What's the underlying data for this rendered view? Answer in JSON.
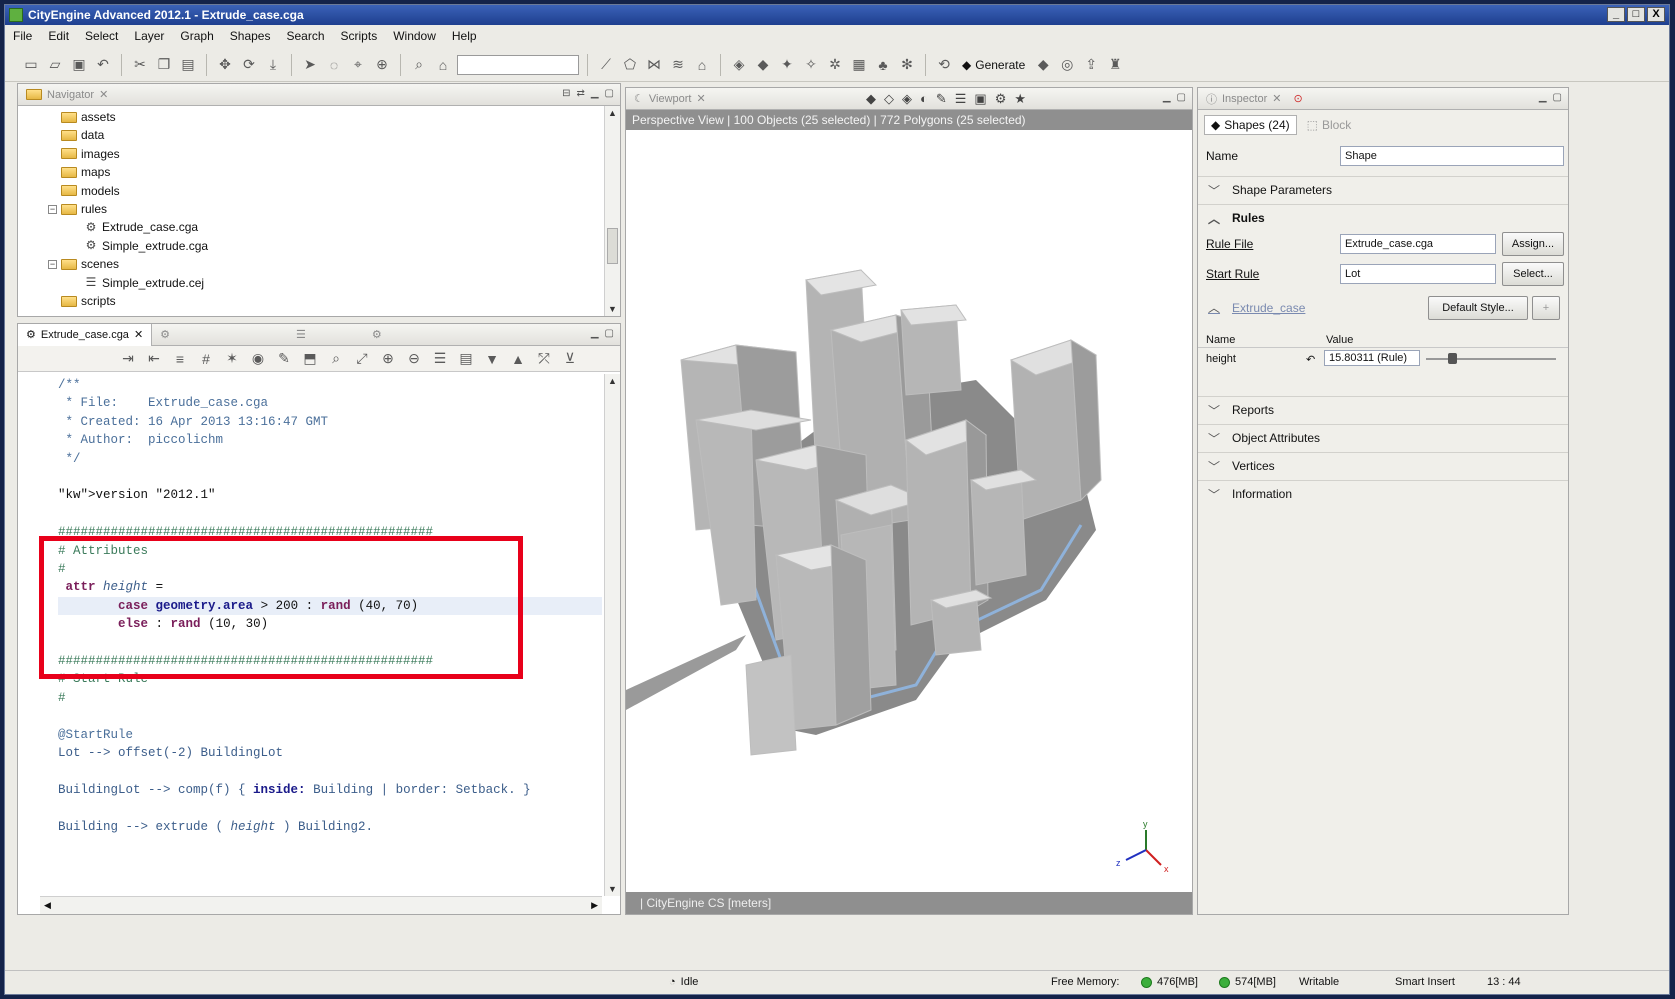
{
  "window": {
    "title": "CityEngine Advanced 2012.1 - Extrude_case.cga",
    "min": "_",
    "max": "□",
    "close": "X"
  },
  "menu": [
    "File",
    "Edit",
    "Select",
    "Layer",
    "Graph",
    "Shapes",
    "Search",
    "Scripts",
    "Window",
    "Help"
  ],
  "toolbar": {
    "generate_label": "Generate",
    "search_value": ""
  },
  "navigator": {
    "tab": "Navigator",
    "items": [
      {
        "label": "assets",
        "type": "folder",
        "depth": 1
      },
      {
        "label": "data",
        "type": "folder",
        "depth": 1
      },
      {
        "label": "images",
        "type": "folder",
        "depth": 1
      },
      {
        "label": "maps",
        "type": "folder",
        "depth": 1
      },
      {
        "label": "models",
        "type": "folder",
        "depth": 1
      },
      {
        "label": "rules",
        "type": "folder",
        "depth": 1,
        "expanded": true
      },
      {
        "label": "Extrude_case.cga",
        "type": "rule",
        "depth": 2
      },
      {
        "label": "Simple_extrude.cga",
        "type": "rule",
        "depth": 2
      },
      {
        "label": "scenes",
        "type": "folder",
        "depth": 1,
        "expanded": true
      },
      {
        "label": "Simple_extrude.cej",
        "type": "scene",
        "depth": 2
      },
      {
        "label": "scripts",
        "type": "folder",
        "depth": 1
      }
    ]
  },
  "editor": {
    "tab": "Extrude_case.cga",
    "lines": [
      {
        "t": "/**",
        "c": "cm"
      },
      {
        "t": " * File:    Extrude_case.cga",
        "c": "cm"
      },
      {
        "t": " * Created: 16 Apr 2013 13:16:47 GMT",
        "c": "cm"
      },
      {
        "t": " * Author:  piccolichm",
        "c": "cm"
      },
      {
        "t": " */",
        "c": "cm"
      },
      {
        "t": "",
        "c": ""
      },
      {
        "t": "version \"2012.1\"",
        "c": "ver"
      },
      {
        "t": "",
        "c": ""
      },
      {
        "t": "##################################################",
        "c": "gr"
      },
      {
        "t": "# Attributes",
        "c": "gr"
      },
      {
        "t": "#",
        "c": "gr"
      },
      {
        "t": " attr height =",
        "c": "attr"
      },
      {
        "t": "        case geometry.area > 200 : rand (40, 70)",
        "c": "case"
      },
      {
        "t": "        else : rand (10, 30)",
        "c": "else"
      },
      {
        "t": "",
        "c": ""
      },
      {
        "t": "##################################################",
        "c": "gr"
      },
      {
        "t": "# Start Rule",
        "c": "gr"
      },
      {
        "t": "#",
        "c": "gr"
      },
      {
        "t": "",
        "c": ""
      },
      {
        "t": "@StartRule",
        "c": "cm"
      },
      {
        "t": "Lot --> offset(-2) BuildingLot",
        "c": "pl"
      },
      {
        "t": "",
        "c": ""
      },
      {
        "t": "BuildingLot --> comp(f) { inside: Building | border: Setback. }",
        "c": "comp"
      },
      {
        "t": "",
        "c": ""
      },
      {
        "t": "Building --> extrude ( height ) Building2.",
        "c": "pl"
      }
    ]
  },
  "viewport": {
    "tab": "Viewport",
    "info": "Perspective View  |  100 Objects  (25 selected)  |  772 Polygons  (25 selected)",
    "footer": "|  CityEngine CS [meters]",
    "axes": {
      "x": "x",
      "y": "y",
      "z": "z"
    }
  },
  "inspector": {
    "tab": "Inspector",
    "subtab_active": "Shapes (24)",
    "subtab_inactive": "Block",
    "name_label": "Name",
    "name_value": "Shape",
    "shape_parameters": "Shape Parameters",
    "rules_label": "Rules",
    "rule_file_label": "Rule File",
    "rule_file_value": "Extrude_case.cga",
    "assign_button": "Assign...",
    "start_rule_label": "Start Rule",
    "start_rule_value": "Lot",
    "select_button": "Select...",
    "rule_link": "Extrude_case",
    "default_style_button": "Default Style...",
    "col_name": "Name",
    "col_value": "Value",
    "attr_name": "height",
    "attr_value": "15.80311 (Rule)",
    "sections": [
      "Reports",
      "Object Attributes",
      "Vertices",
      "Information"
    ]
  },
  "status": {
    "idle": "Idle",
    "free_memory_label": "Free Memory:",
    "mem1": "476[MB]",
    "mem2": "574[MB]",
    "writable": "Writable",
    "insert_mode": "Smart Insert",
    "position": "13 : 44"
  }
}
